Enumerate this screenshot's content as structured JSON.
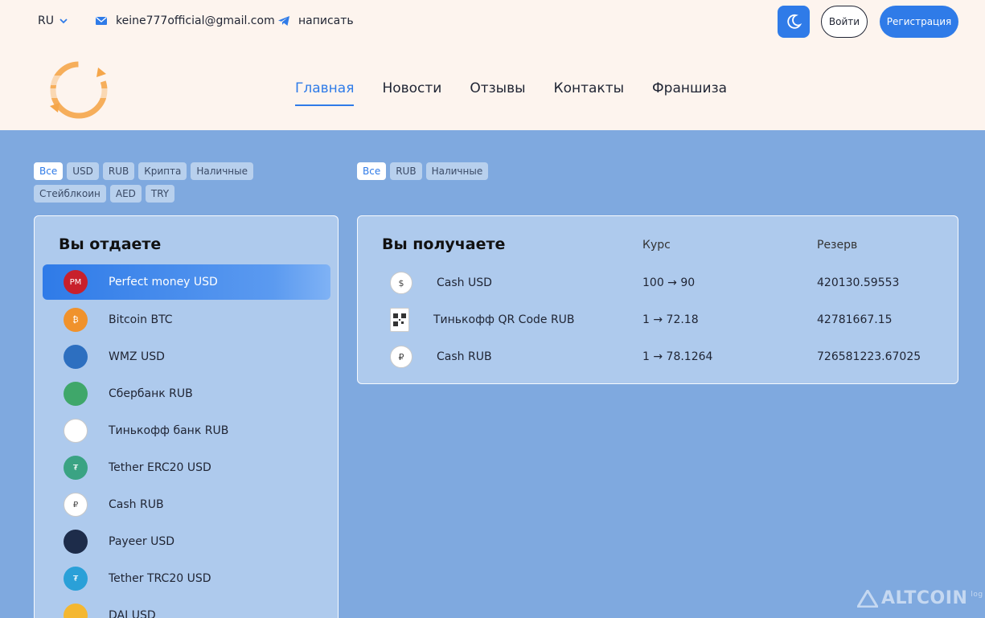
{
  "topbar": {
    "lang": "RU",
    "email": "keine777official@gmail.com",
    "write": "написать",
    "login": "Войти",
    "register": "Регистрация"
  },
  "nav": {
    "items": [
      "Главная",
      "Новости",
      "Отзывы",
      "Контакты",
      "Франшиза"
    ]
  },
  "filters_left": [
    "Все",
    "USD",
    "RUB",
    "Крипта",
    "Наличные",
    "Стейблкоин",
    "AED",
    "TRY"
  ],
  "filters_right": [
    "Все",
    "RUB",
    "Наличные"
  ],
  "give": {
    "title": "Вы отдаете",
    "items": [
      {
        "name": "Perfect money USD",
        "icon": "perfect-money-icon",
        "color": "#c8202c",
        "abbr": "PM"
      },
      {
        "name": "Bitcoin BTC",
        "icon": "bitcoin-icon",
        "color": "#f0922c",
        "abbr": "₿"
      },
      {
        "name": "WMZ USD",
        "icon": "webmoney-icon",
        "color": "#2d6fc0",
        "abbr": ""
      },
      {
        "name": "Сбербанк RUB",
        "icon": "sberbank-icon",
        "color": "#3fa76a",
        "abbr": ""
      },
      {
        "name": "Тинькофф банк RUB",
        "icon": "tinkoff-icon",
        "color": "#ffffff",
        "abbr": ""
      },
      {
        "name": "Tether ERC20 USD",
        "icon": "tether-icon",
        "color": "#3aa383",
        "abbr": "₮"
      },
      {
        "name": "Cash RUB",
        "icon": "cash-icon",
        "color": "#ffffff",
        "abbr": "₽"
      },
      {
        "name": "Payeer USD",
        "icon": "payeer-icon",
        "color": "#1d2c4a",
        "abbr": ""
      },
      {
        "name": "Tether TRC20 USD",
        "icon": "tether-trc20-icon",
        "color": "#2aa0d8",
        "abbr": "₮"
      },
      {
        "name": "DAI USD",
        "icon": "dai-icon",
        "color": "#f4b731",
        "abbr": ""
      }
    ]
  },
  "receive": {
    "title": "Вы получаете",
    "rate_header": "Курс",
    "reserve_header": "Резерв",
    "items": [
      {
        "name": "Cash USD",
        "rate": "100 → 90",
        "reserve": "420130.59553",
        "icon": "cash-usd-icon",
        "sym": "$"
      },
      {
        "name": "Тинькофф QR Code RUB",
        "rate": "1 → 72.18",
        "reserve": "42781667.15",
        "icon": "tinkoff-qr-icon",
        "sym": ""
      },
      {
        "name": "Cash RUB",
        "rate": "1 → 78.1264",
        "reserve": "726581223.67025",
        "icon": "cash-rub-icon",
        "sym": "₽"
      }
    ]
  },
  "watermark": "ALTCOIN",
  "watermark_sub": "log"
}
